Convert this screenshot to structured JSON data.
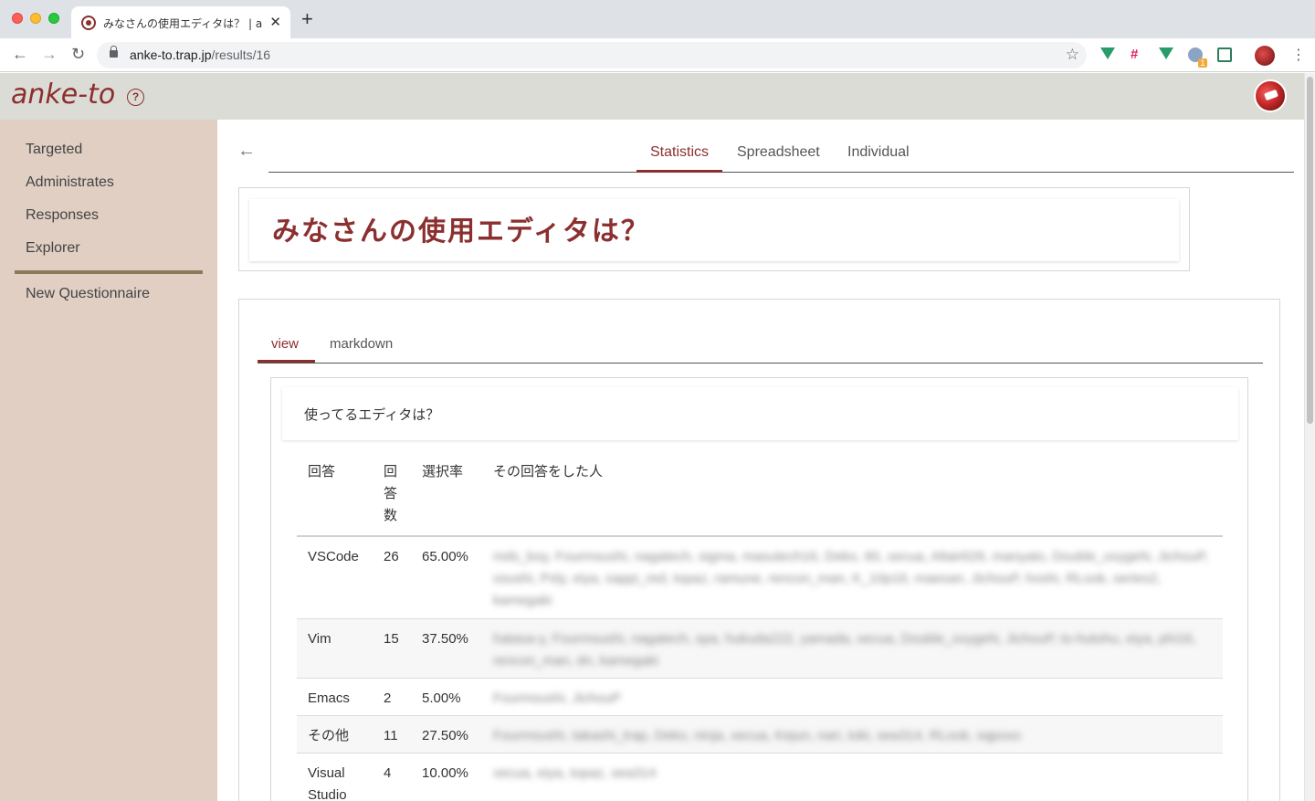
{
  "browser": {
    "tab_title": "みなさんの使用エディタは？ | anke-to",
    "tab_close": "✕",
    "new_tab": "+",
    "url_host": "anke-to.trap.jp",
    "url_path": "/results/16",
    "back": "←",
    "forward": "→",
    "reload": "↻",
    "star": "☆",
    "menu": "⋮",
    "extension_badge": "1"
  },
  "app": {
    "logo": "anke-to",
    "help": "?",
    "accent_color": "#8b2f2f",
    "sidebar_color": "#e0cfc2"
  },
  "sidebar": {
    "items": [
      {
        "label": "Targeted"
      },
      {
        "label": "Administrates"
      },
      {
        "label": "Responses"
      },
      {
        "label": "Explorer"
      }
    ],
    "new_questionnaire": "New Questionnaire"
  },
  "main": {
    "back": "←",
    "tabs": [
      {
        "label": "Statistics",
        "active": true
      },
      {
        "label": "Spreadsheet",
        "active": false
      },
      {
        "label": "Individual",
        "active": false
      }
    ],
    "title": "みなさんの使用エディタは？",
    "sub_tabs": [
      {
        "label": "view",
        "active": true
      },
      {
        "label": "markdown",
        "active": false
      }
    ],
    "question": "使ってるエディタは？",
    "table": {
      "headers": [
        "回答",
        "回\n答\n数",
        "選択率",
        "その回答をした人"
      ],
      "rows": [
        {
          "answer": "VSCode",
          "count": "26",
          "rate": "65.00%",
          "people": "mds_boy, Fourmsushi, nagatech, sigma, masutech16, Deko, 60, xecua, Altair626, manyato, Double_oxygeN, JichouP, osushi, Pxly, eiya, sappi_red, topaz, ramune, rencon_man, K_10p16, maesan, JichouP, hoshi, RLook, series2, kamegaki"
        },
        {
          "answer": "Vim",
          "count": "15",
          "rate": "37.50%",
          "people": "hatasa-y, Fourmsushi, nagatech, spa, hukuda222, yamada, xecua, Double_oxygeN, JichouP, to-hutohu, eiya, phi16, rencon_man, dn, kamegaki"
        },
        {
          "answer": "Emacs",
          "count": "2",
          "rate": "5.00%",
          "people": "Fourmsushi, JichouP"
        },
        {
          "answer": "その他",
          "count": "11",
          "rate": "27.50%",
          "people": "Fourmsushi, takashi_trap, Deko, ninja, xecua, Kejun, nari, toki, sea314, RLook, sqpoxo"
        },
        {
          "answer": "Visual Studio",
          "count": "4",
          "rate": "10.00%",
          "people": "xecua, eiya, topaz, sea314"
        }
      ]
    }
  }
}
